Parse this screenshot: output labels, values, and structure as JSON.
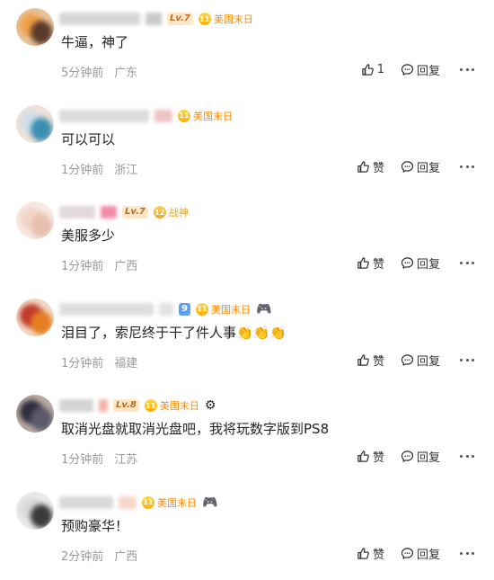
{
  "comments": [
    {
      "level": "Lv.7",
      "level_style": "gold",
      "badge_num": "11",
      "badge_text": "美国末日",
      "text": "牛逼，神了",
      "time": "5分钟前",
      "location": "广东",
      "like_label": "1",
      "reply_label": "回复",
      "avatar_colors": [
        "#f0a04a",
        "#5a3a2a",
        "#e8c39a"
      ]
    },
    {
      "level": "",
      "level_style": "gold",
      "badge_num": "11",
      "badge_text": "美国末日",
      "text": "可以可以",
      "time": "1分钟前",
      "location": "浙江",
      "like_label": "赞",
      "reply_label": "回复",
      "avatar_colors": [
        "#cfe0ea",
        "#3b8fb2",
        "#f1e0d8"
      ]
    },
    {
      "level": "Lv.7",
      "level_style": "gold",
      "badge_num": "12",
      "badge_text": "战神",
      "text": "美服多少",
      "time": "1分钟前",
      "location": "广西",
      "like_label": "赞",
      "reply_label": "回复",
      "avatar_colors": [
        "#f3d6c9",
        "#e7bfae",
        "#f8e9e2"
      ]
    },
    {
      "level": "9",
      "level_style": "blue",
      "badge_num": "11",
      "badge_text": "美国末日",
      "text": "泪目了，索尼终于干了件人事👏👏👏",
      "time": "1分钟前",
      "location": "福建",
      "like_label": "赞",
      "reply_label": "回复",
      "extra_icon": "🎮",
      "avatar_colors": [
        "#c0392b",
        "#e67e22",
        "#f2d9c4"
      ]
    },
    {
      "level": "Lv.8",
      "level_style": "gold",
      "badge_num": "11",
      "badge_text": "美国末日",
      "text": "取消光盘就取消光盘吧，我将玩数字版到PS8",
      "time": "1分钟前",
      "location": "江苏",
      "like_label": "赞",
      "reply_label": "回复",
      "extra_icon": "⚙",
      "avatar_colors": [
        "#2c2c3c",
        "#5b5b6b",
        "#b8a8a0"
      ]
    },
    {
      "level": "",
      "level_style": "gold",
      "badge_num": "11",
      "badge_text": "美国末日",
      "text": "预购豪华！",
      "time": "2分钟前",
      "location": "广西",
      "like_label": "赞",
      "reply_label": "回复",
      "extra_icon": "🎮",
      "avatar_colors": [
        "#d9d9d9",
        "#3a3a3a",
        "#eaeaea"
      ]
    }
  ]
}
